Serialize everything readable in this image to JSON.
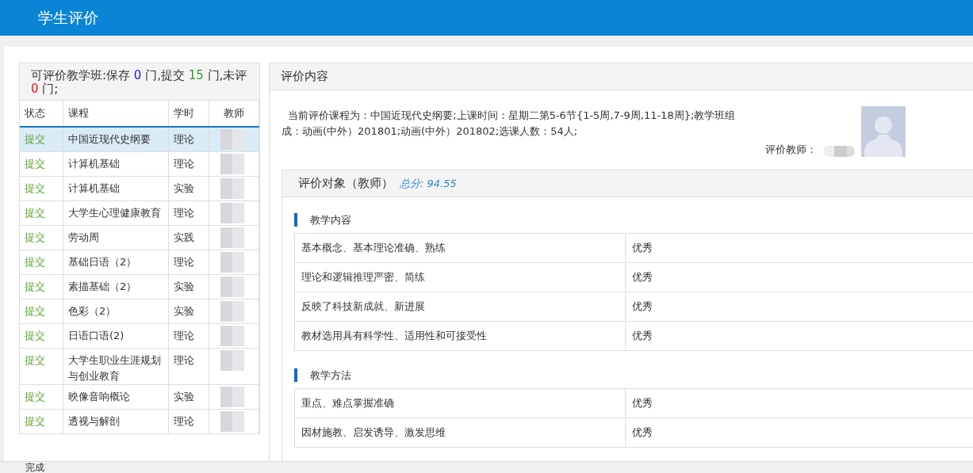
{
  "header": {
    "title": "学生评价"
  },
  "course_list": {
    "summary": [
      {
        "kind": "text",
        "text": "可评价教学班:保存 "
      },
      {
        "kind": "saved",
        "text": "0"
      },
      {
        "kind": "text",
        "text": " 门,提交 "
      },
      {
        "kind": "submitted",
        "text": "15"
      },
      {
        "kind": "text",
        "text": " 门,未评 "
      },
      {
        "kind": "unrated",
        "text": "0"
      },
      {
        "kind": "text",
        "text": " 门;"
      }
    ],
    "columns": [
      "状态",
      "课程",
      "学时",
      "教师"
    ],
    "rows": [
      {
        "status": "提交",
        "course": "中国近现代史纲要",
        "hours": "理论",
        "selected": true
      },
      {
        "status": "提交",
        "course": "计算机基础",
        "hours": "理论",
        "selected": false
      },
      {
        "status": "提交",
        "course": "计算机基础",
        "hours": "实验",
        "selected": false
      },
      {
        "status": "提交",
        "course": "大学生心理健康教育",
        "hours": "理论",
        "selected": false
      },
      {
        "status": "提交",
        "course": "劳动周",
        "hours": "实践",
        "selected": false
      },
      {
        "status": "提交",
        "course": "基础日语（2）",
        "hours": "理论",
        "selected": false
      },
      {
        "status": "提交",
        "course": "素描基础（2）",
        "hours": "实验",
        "selected": false
      },
      {
        "status": "提交",
        "course": "色彩（2）",
        "hours": "实验",
        "selected": false
      },
      {
        "status": "提交",
        "course": "日语口语(2)",
        "hours": "理论",
        "selected": false
      },
      {
        "status": "提交",
        "course": "大学生职业生涯规划与创业教育",
        "hours": "理论",
        "selected": false
      },
      {
        "status": "提交",
        "course": "映像音响概论",
        "hours": "实验",
        "selected": false
      },
      {
        "status": "提交",
        "course": "透视与解剖",
        "hours": "理论",
        "selected": false
      }
    ]
  },
  "content": {
    "title": "评价内容",
    "course_info": "当前评价课程为：中国近现代史纲要;上课时间：星期二第5-6节{1-5周,7-9周,11-18周};教学班组成：动画(中外）201801;动画(中外）201802;选课人数：54人;",
    "teacher_label": "评价教师：",
    "target_title": "评价对象（教师）",
    "total_score": "总分: 94.55",
    "sections": [
      {
        "title": "教学内容",
        "items": [
          {
            "criterion": "基本概念、基本理论准确、熟练",
            "rating": "优秀"
          },
          {
            "criterion": "理论和逻辑推理严密、简练",
            "rating": "优秀"
          },
          {
            "criterion": "反映了科技新成就、新进展",
            "rating": "优秀"
          },
          {
            "criterion": "教材选用具有科学性、适用性和可接受性",
            "rating": "优秀"
          }
        ]
      },
      {
        "title": "教学方法",
        "items": [
          {
            "criterion": "重点、难点掌握准确",
            "rating": "优秀"
          },
          {
            "criterion": "因材施教、启发诱导、激发思维",
            "rating": "优秀"
          }
        ]
      }
    ]
  },
  "status_bar": {
    "text": "完成"
  }
}
